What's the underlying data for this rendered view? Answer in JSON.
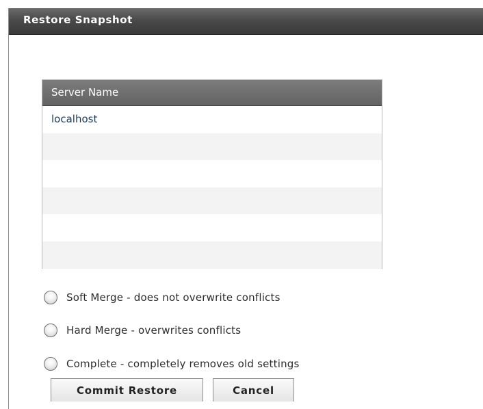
{
  "dialog": {
    "title": "Restore Snapshot"
  },
  "server_table": {
    "header": "Server Name",
    "rows": [
      "localhost",
      "",
      "",
      "",
      "",
      "",
      ""
    ]
  },
  "restore_options": [
    {
      "label": "Soft Merge - does not overwrite conflicts",
      "selected": false
    },
    {
      "label": "Hard Merge - overwrites conflicts",
      "selected": false
    },
    {
      "label": "Complete - completely removes old settings",
      "selected": false
    }
  ],
  "buttons": {
    "commit_label": "Commit Restore",
    "cancel_label": "Cancel"
  }
}
